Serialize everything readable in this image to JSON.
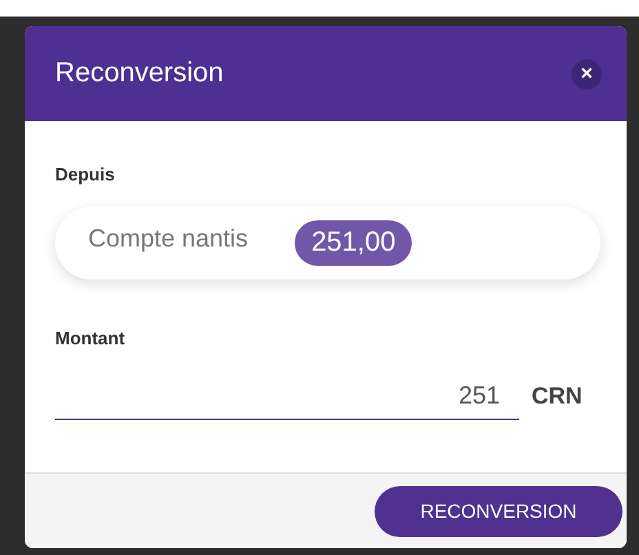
{
  "dialog": {
    "title": "Reconversion",
    "close": "×"
  },
  "source": {
    "label": "Depuis",
    "account": "Compte nantis",
    "balance": "251,00"
  },
  "amount": {
    "label": "Montant",
    "value": "251",
    "currency": "CRN"
  },
  "buttons": [
    {
      "label": "RECONVERSION"
    }
  ]
}
